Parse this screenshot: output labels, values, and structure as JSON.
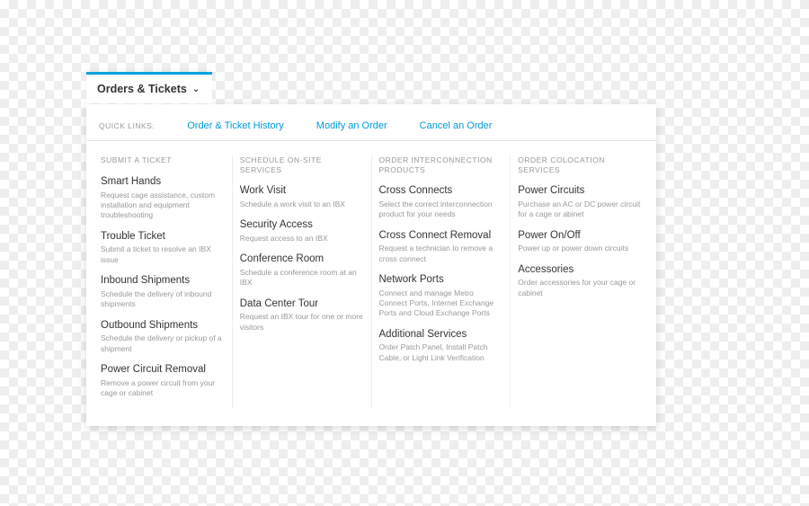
{
  "tab": {
    "label": "Orders & Tickets"
  },
  "quicklinks": {
    "label": "QUICK LINKS:",
    "links": {
      "history": "Order & Ticket History",
      "modify": "Modify an Order",
      "cancel": "Cancel an Order"
    }
  },
  "columns": {
    "submit": {
      "header": "SUBMIT A TICKET",
      "items": [
        {
          "title": "Smart Hands",
          "desc": "Request cage assistance, custom installation and equipment troubleshooting"
        },
        {
          "title": "Trouble Ticket",
          "desc": "Submit a ticket to resolve an IBX issue"
        },
        {
          "title": "Inbound Shipments",
          "desc": "Schedule the delivery of inbound shipments"
        },
        {
          "title": "Outbound Shipments",
          "desc": "Schedule the delivery or pickup of a shipment"
        },
        {
          "title": "Power Circuit Removal",
          "desc": "Remove a power circuit from your cage or cabinet"
        }
      ]
    },
    "onsite": {
      "header": "SCHEDULE ON-SITE SERVICES",
      "items": [
        {
          "title": "Work Visit",
          "desc": "Schedule a work visit to an IBX"
        },
        {
          "title": "Security Access",
          "desc": "Request access to an IBX"
        },
        {
          "title": "Conference Room",
          "desc": "Schedule a conference room at an IBX"
        },
        {
          "title": "Data Center Tour",
          "desc": "Request an IBX tour for one or more visitors"
        }
      ]
    },
    "interconnect": {
      "header": "ORDER INTERCONNECTION PRODUCTS",
      "items": [
        {
          "title": "Cross Connects",
          "desc": "Select the correct interconnection product for your needs"
        },
        {
          "title": "Cross Connect Removal",
          "desc": "Request a technician to remove a cross connect"
        },
        {
          "title": "Network Ports",
          "desc": "Connect and manage Metro Connect Ports, Internet Exchange Ports and Cloud Exchange Ports"
        },
        {
          "title": "Additional Services",
          "desc": "Order Patch Panel, Install Patch Cable, or Light Link Verification"
        }
      ]
    },
    "colocation": {
      "header": "ORDER COLOCATION SERVICES",
      "items": [
        {
          "title": "Power Circuits",
          "desc": "Purchase an AC or DC power circuit for a cage or abinet"
        },
        {
          "title": "Power On/Off",
          "desc": "Power up or power down circuits"
        },
        {
          "title": "Accessories",
          "desc": "Order accessories for your cage or cabinet"
        }
      ]
    }
  }
}
